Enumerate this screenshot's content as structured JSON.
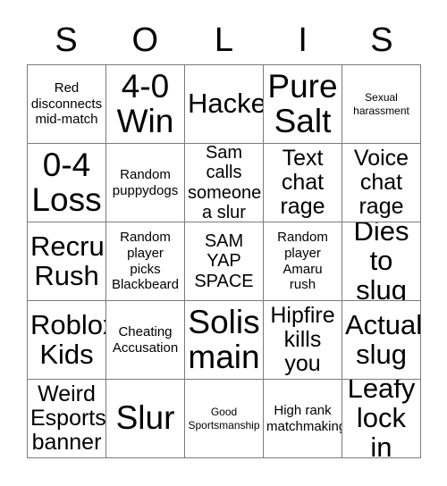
{
  "card": {
    "title_letters": [
      "S",
      "O",
      "L",
      "I",
      "S"
    ],
    "grid_size": 5,
    "colors": {
      "background": "#ffffff",
      "cell_background": "#ffffff",
      "border": "#7b7b7b",
      "text": "#000000"
    },
    "cells": [
      {
        "text": "Red\ndisconnects\nmid-match",
        "size": "sm",
        "marked": false
      },
      {
        "text": "4-0\nWin",
        "size": "xxl",
        "marked": false
      },
      {
        "text": "Hacker",
        "size": "xl",
        "marked": false
      },
      {
        "text": "Pure\nSalt",
        "size": "xxl",
        "marked": false
      },
      {
        "text": "Sexual\nharassment",
        "size": "xs",
        "marked": false
      },
      {
        "text": "0-4\nLoss",
        "size": "xxl",
        "marked": false
      },
      {
        "text": "Random\npuppydogs",
        "size": "sm",
        "marked": false
      },
      {
        "text": "Sam calls\nsomeone\na slur",
        "size": "md",
        "marked": false
      },
      {
        "text": "Text\nchat\nrage",
        "size": "lg",
        "marked": false
      },
      {
        "text": "Voice\nchat\nrage",
        "size": "lg",
        "marked": false
      },
      {
        "text": "Recruit\nRush",
        "size": "xl",
        "marked": false
      },
      {
        "text": "Random\nplayer\npicks\nBlackbeard",
        "size": "sm",
        "marked": false
      },
      {
        "text": "SAM\nYAP\nSPACE",
        "size": "md",
        "marked": false
      },
      {
        "text": "Random\nplayer\nAmaru\nrush",
        "size": "sm",
        "marked": false
      },
      {
        "text": "Dies\nto slug",
        "size": "xl",
        "marked": false
      },
      {
        "text": "Roblox\nKids",
        "size": "xl",
        "marked": false
      },
      {
        "text": "Cheating\nAccusation",
        "size": "sm",
        "marked": false
      },
      {
        "text": "Solis\nmain",
        "size": "xxl",
        "marked": false
      },
      {
        "text": "Hipfire\nkills\nyou",
        "size": "lg",
        "marked": false
      },
      {
        "text": "Actual\nslug",
        "size": "xl",
        "marked": false
      },
      {
        "text": "Weird\nEsports\nbanner",
        "size": "lg",
        "marked": false
      },
      {
        "text": "Slur",
        "size": "xxl",
        "marked": false
      },
      {
        "text": "Good\nSportsmanship",
        "size": "xs",
        "marked": false
      },
      {
        "text": "High rank\nmatchmaking",
        "size": "sm",
        "marked": false
      },
      {
        "text": "Leafy\nlock in",
        "size": "xl",
        "marked": false
      }
    ]
  }
}
